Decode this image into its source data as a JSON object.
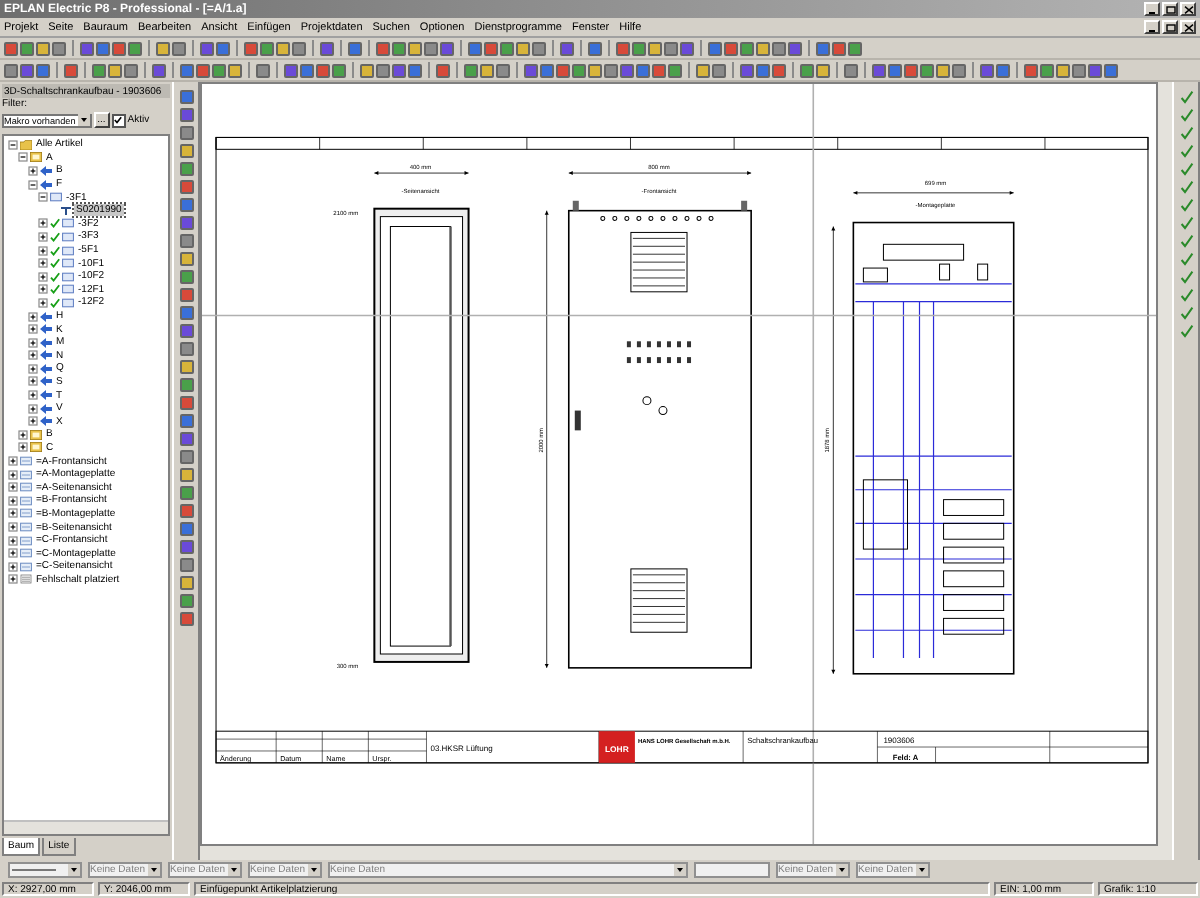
{
  "window": {
    "title": "EPLAN Electric P8 - Professional - [=A/1.a]"
  },
  "menu": [
    "Projekt",
    "Seite",
    "Bauraum",
    "Bearbeiten",
    "Ansicht",
    "Einfügen",
    "Projektdaten",
    "Suchen",
    "Optionen",
    "Dienstprogramme",
    "Fenster",
    "Hilfe"
  ],
  "panel": {
    "title": "3D-Schaltschrankaufbau - 1903606",
    "filter_label": "Filter:",
    "filter_value": "Makro vorhanden",
    "browse_button": "...",
    "active": {
      "label": "Aktiv",
      "checked": true
    },
    "tree": [
      {
        "label": "Alle Artikel",
        "kind": "folder",
        "expanded": true,
        "selected": false,
        "children": [
          {
            "label": "A",
            "kind": "group",
            "expanded": true,
            "selected": false,
            "children": [
              {
                "label": "B",
                "kind": "part",
                "expanded": false,
                "selected": false
              },
              {
                "label": "F",
                "kind": "part",
                "expanded": true,
                "selected": false,
                "children": [
                  {
                    "label": "-3F1",
                    "kind": "device",
                    "expanded": true,
                    "selected": false,
                    "children": [
                      {
                        "label": "S0201990",
                        "kind": "macro",
                        "selected": true
                      }
                    ]
                  },
                  {
                    "label": "-3F2",
                    "kind": "device",
                    "expanded": false,
                    "selected": false,
                    "placed": true
                  },
                  {
                    "label": "-3F3",
                    "kind": "device",
                    "expanded": false,
                    "selected": false,
                    "placed": true
                  },
                  {
                    "label": "-5F1",
                    "kind": "device",
                    "expanded": false,
                    "selected": false,
                    "placed": true
                  },
                  {
                    "label": "-10F1",
                    "kind": "device",
                    "expanded": false,
                    "selected": false,
                    "placed": true
                  },
                  {
                    "label": "-10F2",
                    "kind": "device",
                    "expanded": false,
                    "selected": false,
                    "placed": true
                  },
                  {
                    "label": "-12F1",
                    "kind": "device",
                    "expanded": false,
                    "selected": false,
                    "placed": true
                  },
                  {
                    "label": "-12F2",
                    "kind": "device",
                    "expanded": false,
                    "selected": false,
                    "placed": true
                  }
                ]
              },
              {
                "label": "H",
                "kind": "part",
                "expanded": false,
                "selected": false
              },
              {
                "label": "K",
                "kind": "part",
                "expanded": false,
                "selected": false
              },
              {
                "label": "M",
                "kind": "part",
                "expanded": false,
                "selected": false
              },
              {
                "label": "N",
                "kind": "part",
                "expanded": false,
                "selected": false
              },
              {
                "label": "Q",
                "kind": "part",
                "expanded": false,
                "selected": false
              },
              {
                "label": "S",
                "kind": "part",
                "expanded": false,
                "selected": false
              },
              {
                "label": "T",
                "kind": "part",
                "expanded": false,
                "selected": false
              },
              {
                "label": "V",
                "kind": "part",
                "expanded": false,
                "selected": false
              },
              {
                "label": "X",
                "kind": "part",
                "expanded": false,
                "selected": false
              }
            ]
          },
          {
            "label": "B",
            "kind": "group",
            "expanded": false,
            "selected": false
          },
          {
            "label": "C",
            "kind": "group",
            "expanded": false,
            "selected": false
          }
        ]
      },
      {
        "label": "=A-Frontansicht",
        "kind": "view",
        "expanded": false,
        "selected": false
      },
      {
        "label": "=A-Montageplatte",
        "kind": "view",
        "expanded": false,
        "selected": false
      },
      {
        "label": "=A-Seitenansicht",
        "kind": "view",
        "expanded": false,
        "selected": false
      },
      {
        "label": "=B-Frontansicht",
        "kind": "view",
        "expanded": false,
        "selected": false
      },
      {
        "label": "=B-Montageplatte",
        "kind": "view",
        "expanded": false,
        "selected": false
      },
      {
        "label": "=B-Seitenansicht",
        "kind": "view",
        "expanded": false,
        "selected": false
      },
      {
        "label": "=C-Frontansicht",
        "kind": "view",
        "expanded": false,
        "selected": false
      },
      {
        "label": "=C-Montageplatte",
        "kind": "view",
        "expanded": false,
        "selected": false
      },
      {
        "label": "=C-Seitenansicht",
        "kind": "view",
        "expanded": false,
        "selected": false
      },
      {
        "label": "Fehlschalt platziert",
        "kind": "list",
        "expanded": false,
        "selected": false
      }
    ],
    "tabs": [
      {
        "label": "Baum",
        "selected": true
      },
      {
        "label": "Liste",
        "selected": false
      }
    ]
  },
  "drawing": {
    "side_view": {
      "width": "400 mm",
      "name": "-Seitenansicht",
      "height": "2100 mm",
      "base": "300 mm"
    },
    "front_view": {
      "width": "800 mm",
      "name": "-Frontansicht",
      "height": "2000 mm"
    },
    "mounting_plate": {
      "width": "699 mm",
      "name": "-Montageplatte",
      "height": "1878 mm"
    }
  },
  "title_block": {
    "columns": [
      "Änderung",
      "Datum",
      "Name",
      "Urspr."
    ],
    "description": "03.HKSR Lüftung",
    "logo": "LOHR",
    "company": "HANS LOHR Gesellschaft m.b.H.",
    "title": "Schaltschrankaufbau",
    "number": "1903606",
    "field": "Feld: A"
  },
  "combos": [
    {
      "kind": "line"
    },
    {
      "kind": "text",
      "value": "Keine Daten"
    },
    {
      "kind": "text",
      "value": "Keine Daten"
    },
    {
      "kind": "text",
      "value": "Keine Daten"
    },
    {
      "kind": "wide",
      "value": "Keine Daten"
    },
    {
      "kind": "blank"
    },
    {
      "kind": "text",
      "value": "Keine Daten"
    },
    {
      "kind": "text",
      "value": "Keine Daten"
    }
  ],
  "status_bar": {
    "x": "X: 2927,00 mm",
    "y": "Y: 2046,00 mm",
    "message": "Einfügepunkt Artikelplatzierung",
    "increment": "EIN: 1,00 mm",
    "scale": "Grafik: 1:10"
  }
}
